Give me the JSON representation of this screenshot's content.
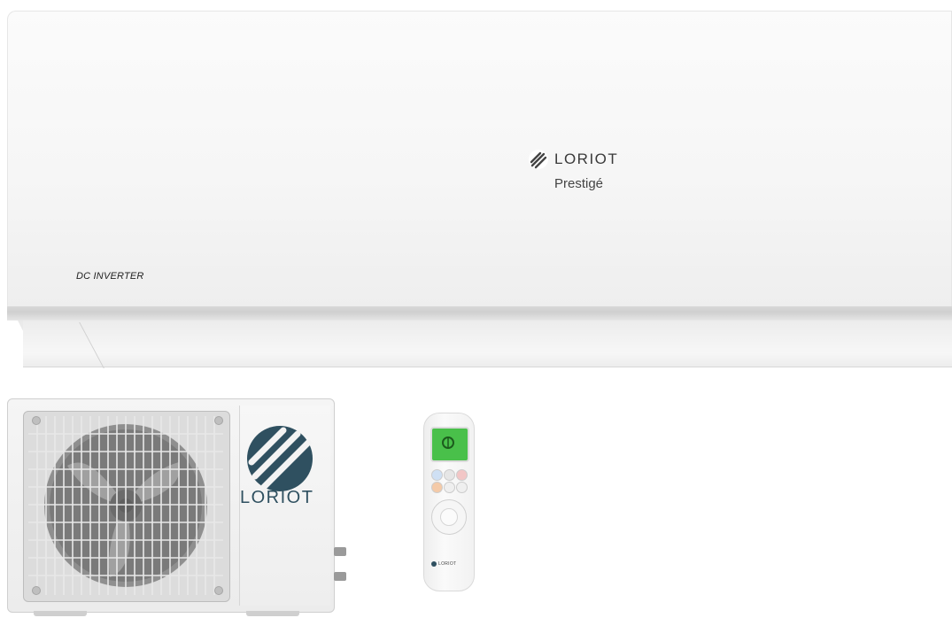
{
  "indoor_unit": {
    "brand": "LORIOT",
    "series": "Prestigé",
    "label": "DC INVERTER"
  },
  "outdoor_unit": {
    "brand": "LORIOT"
  },
  "remote": {
    "brand": "LORIOT"
  },
  "icons": [
    "loriot-logo-icon",
    "fan-icon"
  ],
  "colors": {
    "unit_white": "#f6f6f6",
    "logo_blue": "#2f5060",
    "remote_screen_green": "#49c04a"
  }
}
